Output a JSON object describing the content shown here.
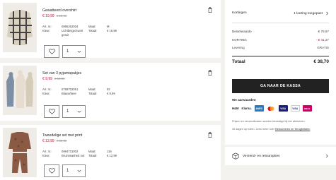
{
  "items": [
    {
      "name": "Gewatteerd overshirt",
      "price_new": "€ 19,99",
      "price_old": "€ 29,99",
      "art_label": "Art. nr.:",
      "art_value": "0995262004",
      "color_label": "Kleur:",
      "color_value": "Lichtbeige/zwart geruit",
      "size_label": "Maat:",
      "size_value": "M",
      "total_label": "Totaal:",
      "total_value": "€ 19,99",
      "quantity": "1"
    },
    {
      "name": "Set van 3 pyjamapakjes",
      "price_new": "€ 9,99",
      "price_old": "€ 19,99",
      "art_label": "Art. nr.:",
      "art_value": "0769702051",
      "color_label": "Kleur:",
      "color_value": "Blauw/beer",
      "size_label": "Maat:",
      "size_value": "92",
      "total_label": "Totaal:",
      "total_value": "€ 9,99",
      "quantity": "1"
    },
    {
      "name": "Tweedelige set met print",
      "price_new": "€ 12,99",
      "price_old": "€ 29,99",
      "art_label": "Art. nr.:",
      "art_value": "0994731002",
      "color_label": "Kleur:",
      "color_value": "Bruin/washed out",
      "size_label": "Maat:",
      "size_value": "116",
      "total_label": "Totaal:",
      "total_value": "€ 12,99",
      "quantity": "1"
    }
  ],
  "summary": {
    "coupons_label": "Kortingen",
    "coupons_value": "1 korting toegepast",
    "order_value_label": "Bestelwaarde",
    "order_value": "€ 79,97",
    "discount_label": "KORTING",
    "discount_value": "- € 41,27",
    "delivery_label": "Levering",
    "delivery_value": "GRATIS",
    "total_label": "Totaal",
    "total_value": "€ 38,70",
    "checkout_label": "GA NAAR DE KASSA",
    "accept_label": "We aanvaarden",
    "payment_methods": [
      "H&M",
      "Klarna.",
      "AMEX",
      "MC",
      "VISA",
      "VISA",
      "iDEAL"
    ],
    "note1": "Prijzen en verzendkosten worden bevestigd bij het afrekenen.",
    "note2_prefix": "30 dagen op ruilen. Lees meer over",
    "note2_link": "Retourneren en Terugbetalen"
  },
  "shipping": {
    "label": "Verzend- en retouropties"
  },
  "colors": {
    "sale_red": "#d6002a",
    "button_dark": "#222222"
  }
}
